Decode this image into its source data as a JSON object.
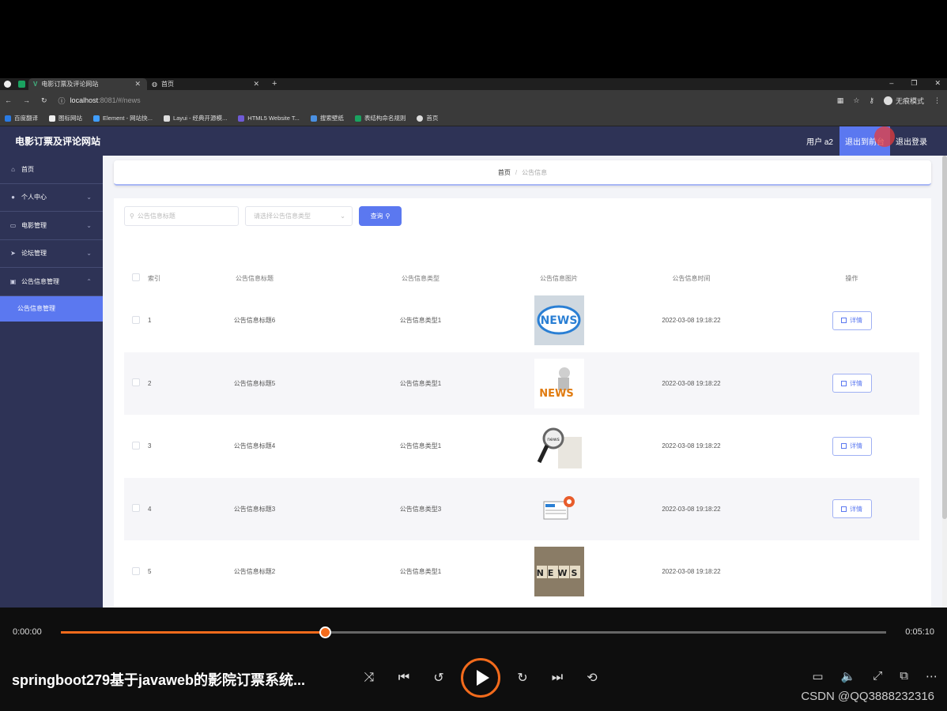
{
  "browser": {
    "tabs": [
      {
        "label": "电影订票及评论网站",
        "active": true
      },
      {
        "label": "首页",
        "active": false
      }
    ],
    "url_host": "localhost",
    "url_path": ":8081/#/news",
    "incognito_label": "无痕模式",
    "bookmarks": [
      "百度翻译",
      "图标网站",
      "Element - 网站快...",
      "Layui - 经典开源模...",
      "HTML5 Website T...",
      "搜索壁纸",
      "表结构命名规则",
      "首页"
    ]
  },
  "header": {
    "title": "电影订票及评论网站",
    "user": "用户 a2",
    "front_button": "退出到前台",
    "logout_button": "退出登录"
  },
  "sidebar": {
    "items": [
      {
        "label": "首页",
        "icon": "home-icon"
      },
      {
        "label": "个人中心",
        "icon": "user-icon"
      },
      {
        "label": "电影管理",
        "icon": "film-icon"
      },
      {
        "label": "论坛管理",
        "icon": "forum-icon"
      },
      {
        "label": "公告信息管理",
        "icon": "notice-icon"
      }
    ],
    "sub_item": "公告信息管理"
  },
  "breadcrumb": {
    "home": "首页",
    "separator": "/",
    "current": "公告信息"
  },
  "search": {
    "title_placeholder": "公告信息标题",
    "type_placeholder": "请选择公告信息类型",
    "query_button": "查询"
  },
  "table": {
    "headers": [
      "索引",
      "公告信息标题",
      "公告信息类型",
      "公告信息图片",
      "公告信息时间",
      "操作"
    ],
    "detail_label": "详情",
    "rows": [
      {
        "index": "1",
        "title": "公告信息标题6",
        "type": "公告信息类型1",
        "time": "2022-03-08 19:18:22",
        "image": "news-bubble"
      },
      {
        "index": "2",
        "title": "公告信息标题5",
        "type": "公告信息类型1",
        "time": "2022-03-08 19:18:22",
        "image": "news-figure"
      },
      {
        "index": "3",
        "title": "公告信息标题4",
        "type": "公告信息类型1",
        "time": "2022-03-08 19:18:22",
        "image": "news-magnifier"
      },
      {
        "index": "4",
        "title": "公告信息标题3",
        "type": "公告信息类型3",
        "time": "2022-03-08 19:18:22",
        "image": "news-papers"
      },
      {
        "index": "5",
        "title": "公告信息标题2",
        "type": "公告信息类型1",
        "time": "2022-03-08 19:18:22",
        "image": "news-blocks"
      }
    ]
  },
  "player": {
    "current_time": "0:00:00",
    "total_time": "0:05:10",
    "progress": 0.32,
    "title": "springboot279基于javaweb的影院订票系统...",
    "watermark": "CSDN @QQ3888232316"
  },
  "colors": {
    "sidebar": "#2e3356",
    "accent": "#5b78f0",
    "progress": "#f36b1c"
  }
}
